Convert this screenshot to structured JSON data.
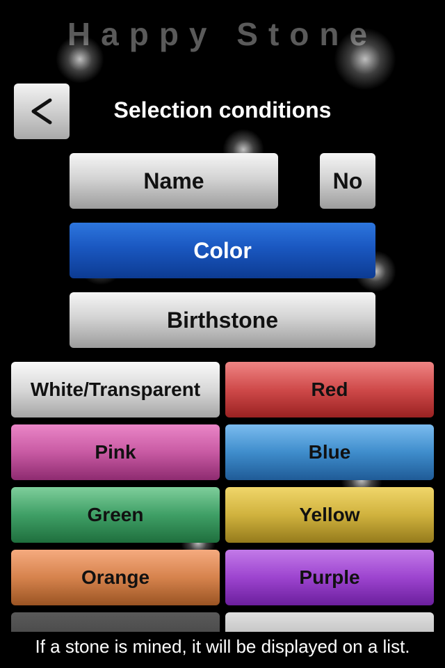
{
  "app": {
    "title": "Happy Stone"
  },
  "header": {
    "back_icon": "chevron-left-icon",
    "title": "Selection conditions"
  },
  "options": {
    "name_label": "Name",
    "no_label": "No",
    "color_label": "Color",
    "birthstone_label": "Birthstone"
  },
  "colors": [
    {
      "label": "White/Transparent"
    },
    {
      "label": "Red"
    },
    {
      "label": "Pink"
    },
    {
      "label": "Blue"
    },
    {
      "label": "Green"
    },
    {
      "label": "Yellow"
    },
    {
      "label": "Orange"
    },
    {
      "label": "Purple"
    }
  ],
  "footer": {
    "text": "If a stone is mined, it will be displayed on a list."
  },
  "theme": {
    "accent": "#1a57c0",
    "background": "#000000"
  }
}
